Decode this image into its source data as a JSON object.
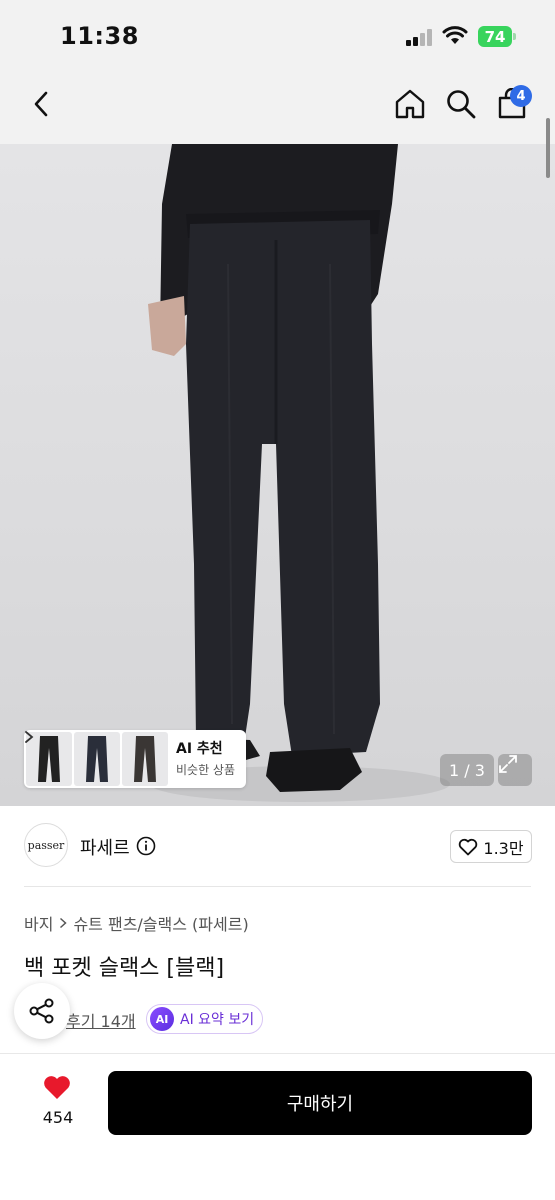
{
  "status_bar": {
    "time": "11:38",
    "battery": "74"
  },
  "nav": {
    "back_icon": "chevron-left-icon",
    "home_icon": "home-icon",
    "search_icon": "search-icon",
    "cart_icon": "shopping-bag-icon",
    "cart_badge": "4"
  },
  "gallery": {
    "thumbnail_count": 3,
    "ai_recommend_title": "AI 추천",
    "ai_recommend_subtitle": "비슷한 상품",
    "page_counter": "1 / 3"
  },
  "seller": {
    "logo_text": "passer",
    "name": "파세르",
    "like_count": "1.3만"
  },
  "product": {
    "breadcrumb": [
      "바지",
      "슈트 팬츠/슬랙스 (파세르)"
    ],
    "title": "백 포켓 슬랙스 [블랙]",
    "reviews_link": "후기 14개",
    "ai_badge": "AI",
    "ai_summary_label": "AI 요약 보기"
  },
  "bottom_bar": {
    "wish_count": "454",
    "buy_label": "구매하기"
  },
  "colors": {
    "accent_blue": "#2f6be6",
    "battery_green": "#38d45d",
    "ai_purple": "#6a2fd6",
    "heart_red": "#e8192c",
    "buy_button": "#000000"
  }
}
